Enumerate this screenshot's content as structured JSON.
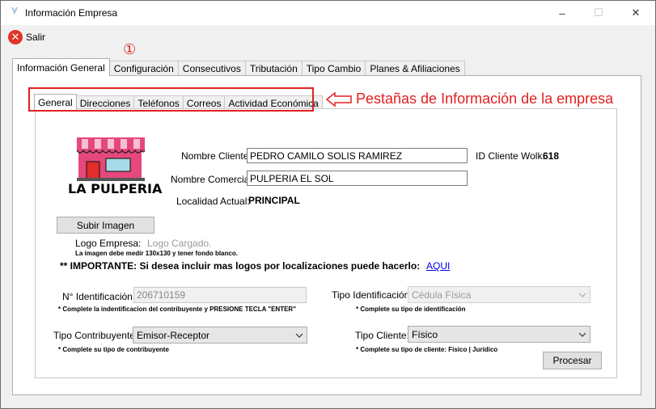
{
  "window": {
    "title": "Información Empresa",
    "controls": {
      "minimize": "–",
      "maximize": "☐",
      "close": "✕"
    }
  },
  "toolbar": {
    "salir_label": "Salir",
    "salir_icon": "close-circle-icon"
  },
  "annotation": {
    "step_marker": "①",
    "callout": "Pestañas de Información de la empresa",
    "color": "#e02020"
  },
  "main_tabs": [
    "Información General",
    "Configuración",
    "Consecutivos",
    "Tributación",
    "Tipo Cambio",
    "Planes & Afiliaciones"
  ],
  "sub_tabs": [
    "General",
    "Direcciones",
    "Teléfonos",
    "Correos",
    "Actividad Económica"
  ],
  "logo": {
    "text": "LA PULPERIA"
  },
  "form": {
    "nombre_cliente_label": "Nombre Cliente:",
    "nombre_cliente_value": "PEDRO CAMILO SOLIS RAMIREZ",
    "id_cliente_label": "ID Cliente Wolk:",
    "id_cliente_value": "618",
    "nombre_comercial_label": "Nombre Comercial:",
    "nombre_comercial_value": "PULPERIA EL SOL",
    "localidad_label": "Localidad Actual:",
    "localidad_value": "PRINCIPAL",
    "subir_imagen_label": "Subir Imagen",
    "logo_empresa_label": "Logo Empresa:",
    "logo_empresa_status": "Logo Cargado.",
    "logo_note": "La imagen debe medir 130x130 y tener fondo blanco.",
    "importante_text": "** IMPORTANTE: Si desea incluir mas logos por localizaciones puede hacerlo:",
    "aqui_link": "AQUI",
    "identificacion_label": "N° Identificación:",
    "identificacion_value": "206710159",
    "identificacion_note": "* Complete la indentificacion del contribuyente y PRESIONE TECLA \"ENTER\"",
    "tipo_identificacion_label": "Tipo Identificación:",
    "tipo_identificacion_value": "Cédula Física",
    "tipo_identificacion_note": "* Complete su tipo de identificación",
    "tipo_contribuyente_label": "Tipo Contribuyente:",
    "tipo_contribuyente_value": "Emisor-Receptor",
    "tipo_contribuyente_note": "* Complete su tipo de contribuyente",
    "tipo_cliente_label": "Tipo Cliente:",
    "tipo_cliente_value": "Físico",
    "tipo_cliente_note": "* Complete su tipo de cliente: Físico | Jurídico",
    "procesar_label": "Procesar"
  }
}
